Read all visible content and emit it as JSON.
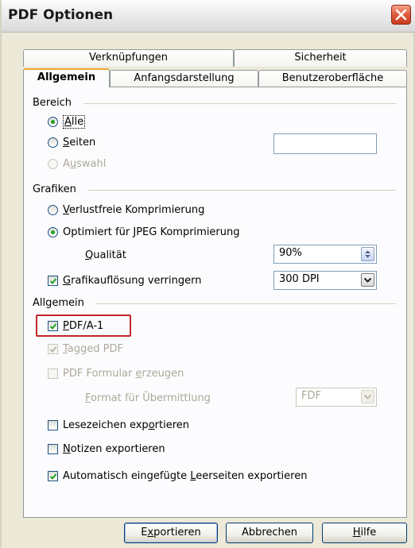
{
  "window": {
    "title": "PDF Optionen"
  },
  "tabs": {
    "row1": [
      "Verknüpfungen",
      "Sicherheit"
    ],
    "row2": [
      "Allgemein",
      "Anfangsdarstellung",
      "Benutzeroberfläche"
    ]
  },
  "bereich": {
    "heading": "Bereich",
    "alle": {
      "pre": "",
      "acc": "A",
      "post": "lle",
      "selected": true
    },
    "seiten": {
      "pre": "",
      "acc": "S",
      "post": "eiten",
      "selected": false,
      "value": ""
    },
    "auswahl": {
      "pre": "A",
      "acc": "u",
      "post": "swahl",
      "enabled": false
    }
  },
  "grafiken": {
    "heading": "Grafiken",
    "verlustfrei": {
      "pre": "",
      "acc": "V",
      "post": "erlustfreie Komprimierung",
      "selected": false
    },
    "jpeg": {
      "pre": "Optimiert für ",
      "acc": "J",
      "post": "PEG Komprimierung",
      "selected": true
    },
    "qualitaet": {
      "pre": "",
      "acc": "Q",
      "post": "ualität",
      "value": "90%"
    },
    "aufloesung": {
      "pre": "",
      "acc": "G",
      "post": "rafikauflösung verringern",
      "checked": true,
      "value": "300 DPI"
    }
  },
  "allgemein": {
    "heading": "Allgemein",
    "pdfa": {
      "pre": "",
      "acc": "P",
      "post": "DF/A-1",
      "checked": true
    },
    "tagged": {
      "pre": "",
      "acc": "T",
      "post": "agged PDF",
      "checked": true,
      "enabled": false
    },
    "formular": {
      "pre": "PDF Formular ",
      "acc": "e",
      "post": "rzeugen",
      "checked": false,
      "enabled": false
    },
    "format": {
      "pre": "",
      "acc": "F",
      "post": "ormat für Übermittlung",
      "value": "FDF",
      "enabled": false
    },
    "lesezeichen": {
      "pre": "Lesezeichen exp",
      "acc": "o",
      "post": "rtieren",
      "checked": false
    },
    "notizen": {
      "pre": "",
      "acc": "N",
      "post": "otizen exportieren",
      "checked": false
    },
    "leerseiten": {
      "pre": "Automatisch eingefügte ",
      "acc": "L",
      "post": "eerseiten exportieren",
      "checked": true
    }
  },
  "buttons": {
    "export": {
      "pre": "E",
      "acc": "x",
      "post": "portieren"
    },
    "cancel": {
      "label": "Abbrechen"
    },
    "help": {
      "pre": "",
      "acc": "H",
      "post": "ilfe"
    }
  },
  "colors": {
    "highlight": "#c1272d",
    "radio_dot": "#21a121",
    "tab_accent": "#f0a43a"
  }
}
